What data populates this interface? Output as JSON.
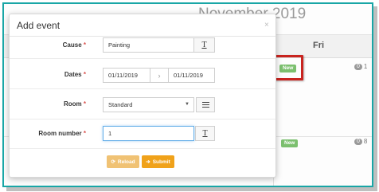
{
  "calendar": {
    "title": "November 2019",
    "day_header": "Fri",
    "cells": [
      {
        "new_label": "New",
        "count": "0",
        "day": "1"
      },
      {
        "new_label": "New",
        "count": "0",
        "day": "8"
      }
    ]
  },
  "modal": {
    "title": "Add event",
    "close_icon": "×",
    "fields": {
      "cause": {
        "label": "Cause",
        "required": "*",
        "value": "Painting"
      },
      "dates": {
        "label": "Dates",
        "required": "*",
        "start": "01/11/2019",
        "separator": "›",
        "end": "01/11/2019"
      },
      "room": {
        "label": "Room",
        "required": "*",
        "selected": "Standard"
      },
      "room_number": {
        "label": "Room number",
        "required": "*",
        "value": "1"
      }
    },
    "buttons": {
      "reload": "Reload",
      "submit": "Submit"
    }
  },
  "colors": {
    "frame": "#19a6a6",
    "highlight": "#c9241f",
    "new_badge": "#7cc06f",
    "reload_button": "#f0c274",
    "submit_button": "#f0a21a",
    "required_star": "#d9534f"
  },
  "icons": {
    "text_icon": "T",
    "list_icon": "list-icon",
    "reload_icon": "⟳",
    "submit_icon": "➔"
  }
}
